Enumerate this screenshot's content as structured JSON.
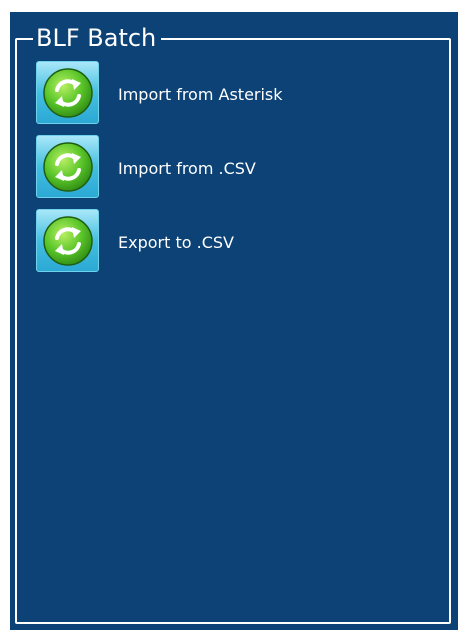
{
  "panel": {
    "title": "BLF Batch",
    "colors": {
      "background": "#0c4276",
      "frame": "#ffffff",
      "button": "#45bfe2",
      "icon": "#5bc62a"
    },
    "items": [
      {
        "label": "Import from Asterisk",
        "icon": "refresh-icon"
      },
      {
        "label": "Import from .CSV",
        "icon": "refresh-icon"
      },
      {
        "label": "Export to .CSV",
        "icon": "refresh-icon"
      }
    ]
  }
}
